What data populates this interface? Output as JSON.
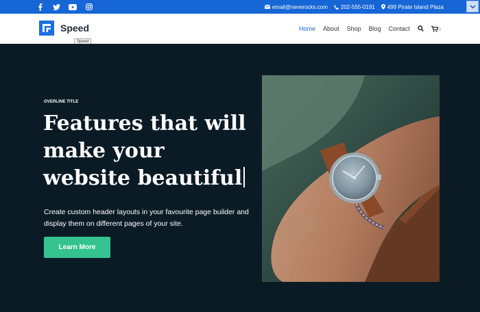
{
  "topbar": {
    "social": [
      "facebook-icon",
      "twitter-icon",
      "youtube-icon",
      "instagram-icon"
    ],
    "email": "email@neverocks.com",
    "phone": "202-555-0191",
    "address": "499 Pirate Island Plaza"
  },
  "header": {
    "brand": "Speed",
    "tooltip": "Speed",
    "nav": [
      "Home",
      "About",
      "Shop",
      "Blog",
      "Contact"
    ],
    "cart_count": "0"
  },
  "hero": {
    "overline": "OVERLINE TITLE",
    "headline": "Features that will make your website beautiful",
    "description": "Create custom header layouts in your favourite page builder and display them on different pages of your site.",
    "cta_label": "Learn More"
  },
  "colors": {
    "topbar": "#1766d6",
    "hero_bg": "#0b1b26",
    "accent": "#34c38f",
    "active_link": "#1766d6"
  }
}
